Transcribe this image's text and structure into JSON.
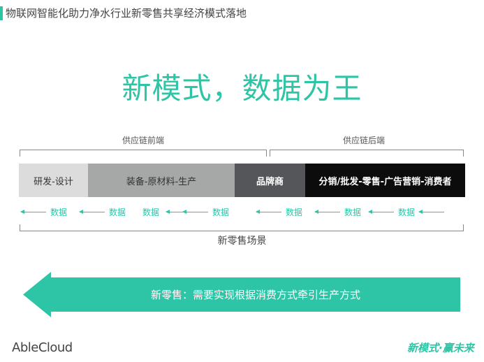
{
  "header": {
    "title": "物联网智能化助力净水行业新零售共享经济模式落地"
  },
  "main_title": "新模式，数据为王",
  "supply_chain": {
    "front_label": "供应链前端",
    "back_label": "供应链后端",
    "segments": [
      "研发-设计",
      "装备-原材料-生产",
      "品牌商",
      "分销/批发-零售-广告营销-消费者"
    ]
  },
  "data_flow": {
    "items": [
      "数据",
      "数据",
      "数据",
      "数据",
      "数据",
      "数据",
      "数据"
    ]
  },
  "scene_label": "新零售场景",
  "banner": {
    "text": "新零售：需要实现根据消费方式牵引生产方式"
  },
  "footer": {
    "logo": "AbleCloud",
    "slogan": "新模式·赢未来"
  },
  "colors": {
    "accent": "#2ec4a6",
    "segment_1": "#dcdcdc",
    "segment_2": "#a6a8a7",
    "segment_3": "#545659",
    "segment_4": "#0c0c0c"
  }
}
